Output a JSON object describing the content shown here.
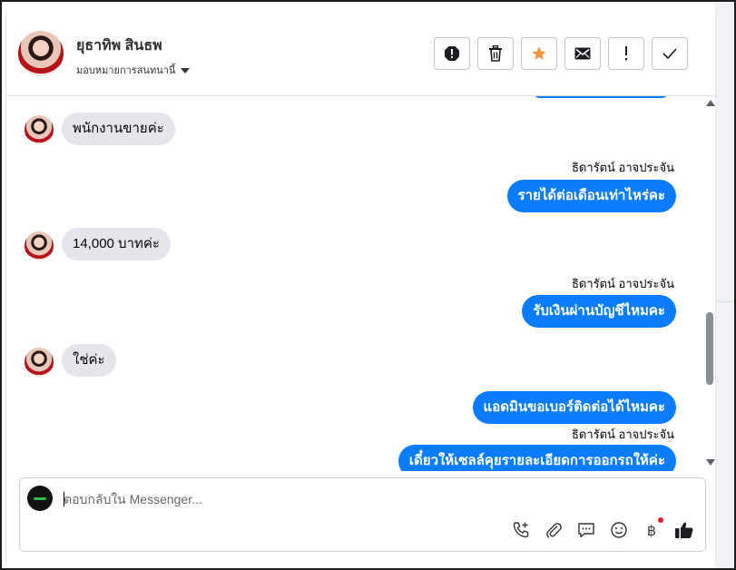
{
  "header": {
    "name": "ยุธาทิพ สินธพ",
    "assign_label": "มอบหมายการสนทนานี้",
    "tools": [
      {
        "name": "spam-button",
        "icon": "exclamation-octagon-icon"
      },
      {
        "name": "delete-button",
        "icon": "trash-icon"
      },
      {
        "name": "star-button",
        "icon": "star-icon"
      },
      {
        "name": "mark-unread-button",
        "icon": "envelope-icon"
      },
      {
        "name": "follow-up-button",
        "icon": "exclamation-icon"
      },
      {
        "name": "done-button",
        "icon": "check-icon"
      }
    ]
  },
  "messages": {
    "m1": {
      "text": "พนักงานขายค่ะ"
    },
    "s1": {
      "sender": "ธิดารัตน์ อาจประจัน"
    },
    "m2": {
      "text": "รายได้ต่อเดือนเท่าไหร่คะ"
    },
    "m3": {
      "text": "14,000 บาทค่ะ"
    },
    "s2": {
      "sender": "ธิดารัตน์ อาจประจัน"
    },
    "m4": {
      "text": "รับเงินผ่านบัญชีไหมคะ"
    },
    "m5": {
      "text": "ใช่ค่ะ"
    },
    "m6": {
      "text": "แอดมินขอเบอร์ติดต่อได้ไหมคะ"
    },
    "s3": {
      "sender": "ธิดารัตน์ อาจประจัน"
    },
    "m7": {
      "text": "เดี๋ยวให้เซลล์คุยรายละเอียดการออกรถให้ค่ะ"
    }
  },
  "composer": {
    "placeholder": "ตอบกลับใน Messenger...",
    "baht_symbol": "฿"
  },
  "colors": {
    "outgoing_bubble": "#0a7cff",
    "incoming_bubble": "#e4e6eb",
    "star": "#f7923a",
    "notification": "#e41e3f"
  }
}
